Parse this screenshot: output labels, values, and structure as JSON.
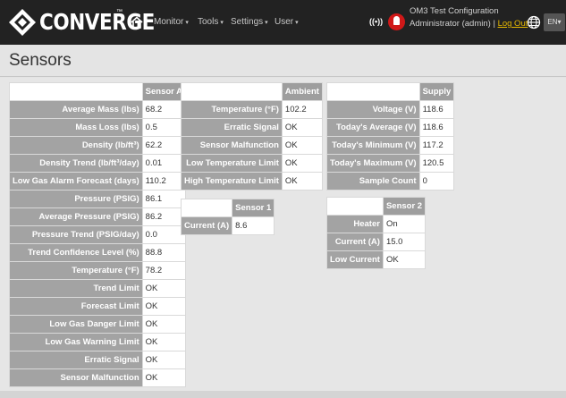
{
  "header": {
    "brand": "CONVERGE",
    "trademark": "™",
    "nav": [
      {
        "label": "Monitor"
      },
      {
        "label": "Tools"
      },
      {
        "label": "Settings"
      },
      {
        "label": "User"
      }
    ],
    "signal": "((•))",
    "config_name": "OM3 Test Configuration",
    "user_text": "Administrator (admin) | ",
    "logout": "Log Out",
    "lang": "EN",
    "caret": "▾"
  },
  "page": {
    "title": "Sensors"
  },
  "sensor_a": {
    "header": "Sensor A",
    "rows": [
      {
        "label": "Average Mass (lbs)",
        "value": "68.2"
      },
      {
        "label": "Mass Loss (lbs)",
        "value": "0.5"
      },
      {
        "label": "Density (lb/ft³)",
        "value": "62.2"
      },
      {
        "label": "Density Trend (lb/ft³/day)",
        "value": "0.01"
      },
      {
        "label": "Low Gas Alarm Forecast (days)",
        "value": "110.2"
      },
      {
        "label": "Pressure (PSIG)",
        "value": "86.1"
      },
      {
        "label": "Average Pressure (PSIG)",
        "value": "86.2"
      },
      {
        "label": "Pressure Trend (PSIG/day)",
        "value": "0.0"
      },
      {
        "label": "Trend Confidence Level (%)",
        "value": "88.8"
      },
      {
        "label": "Temperature (°F)",
        "value": "78.2"
      },
      {
        "label": "Trend Limit",
        "value": "OK"
      },
      {
        "label": "Forecast Limit",
        "value": "OK"
      },
      {
        "label": "Low Gas Danger Limit",
        "value": "OK"
      },
      {
        "label": "Low Gas Warning Limit",
        "value": "OK"
      },
      {
        "label": "Erratic Signal",
        "value": "OK"
      },
      {
        "label": "Sensor Malfunction",
        "value": "OK"
      }
    ]
  },
  "ambient": {
    "header": "Ambient",
    "rows": [
      {
        "label": "Temperature (°F)",
        "value": "102.2"
      },
      {
        "label": "Erratic Signal",
        "value": "OK"
      },
      {
        "label": "Sensor Malfunction",
        "value": "OK"
      },
      {
        "label": "Low Temperature Limit",
        "value": "OK"
      },
      {
        "label": "High Temperature Limit",
        "value": "OK"
      }
    ]
  },
  "sensor_1": {
    "header": "Sensor 1",
    "rows": [
      {
        "label": "Current (A)",
        "value": "8.6"
      }
    ]
  },
  "supply": {
    "header": "Supply",
    "rows": [
      {
        "label": "Voltage (V)",
        "value": "118.6"
      },
      {
        "label": "Today's Average (V)",
        "value": "118.6"
      },
      {
        "label": "Today's Minimum (V)",
        "value": "117.2"
      },
      {
        "label": "Today's Maximum (V)",
        "value": "120.5"
      },
      {
        "label": "Sample Count",
        "value": "0"
      }
    ]
  },
  "sensor_2": {
    "header": "Sensor 2",
    "rows": [
      {
        "label": "Heater",
        "value": "On"
      },
      {
        "label": "Current (A)",
        "value": "15.0"
      },
      {
        "label": "Low Current",
        "value": "OK"
      }
    ]
  }
}
